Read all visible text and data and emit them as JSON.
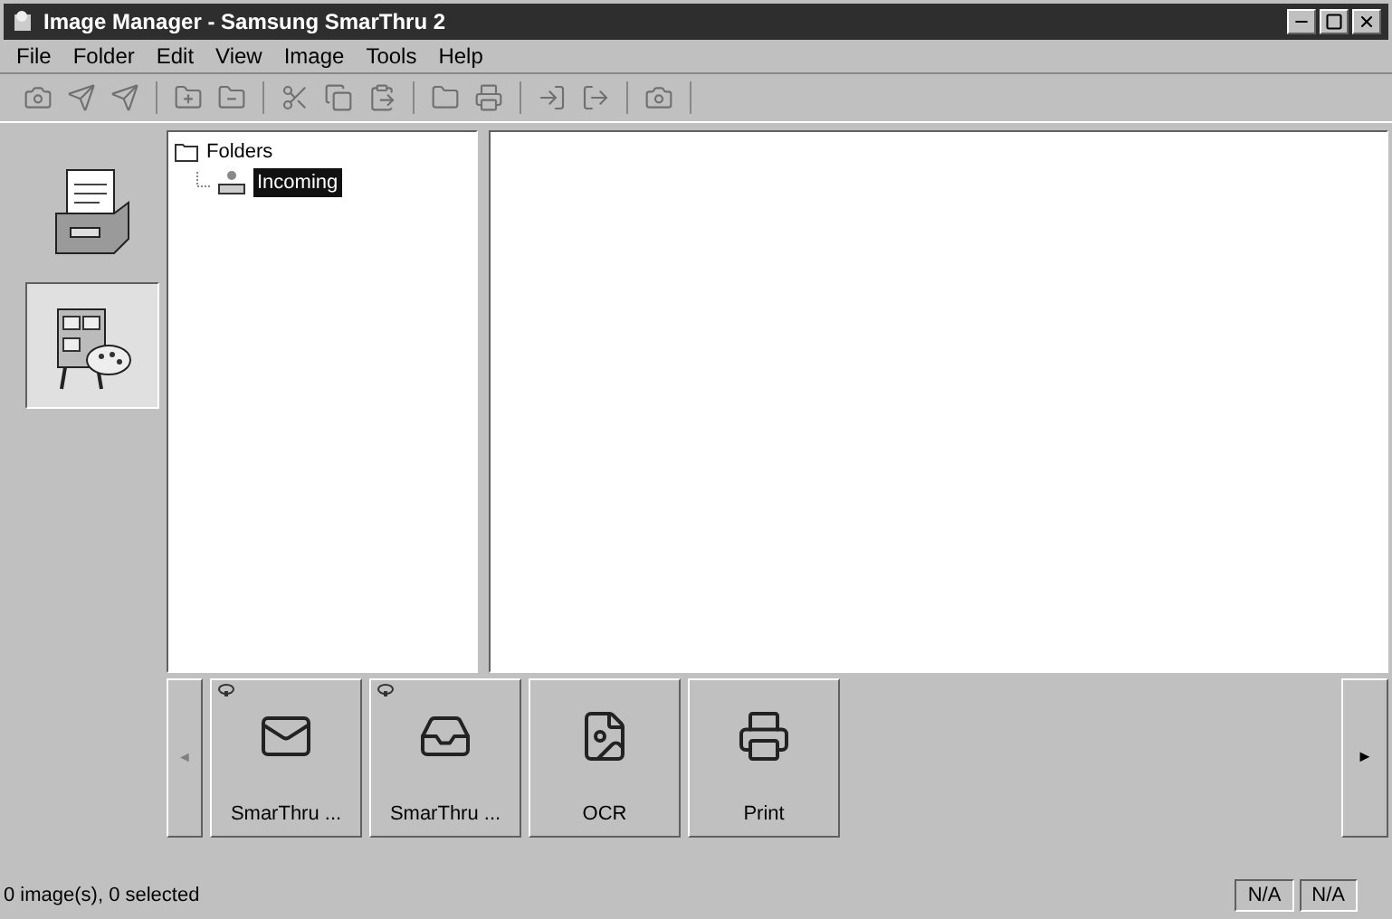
{
  "window": {
    "title": "Image Manager - Samsung SmarThru 2"
  },
  "menu": [
    "File",
    "Folder",
    "Edit",
    "View",
    "Image",
    "Tools",
    "Help"
  ],
  "sidebar": {
    "items": [
      {
        "kind": "cabinet",
        "selected": false
      },
      {
        "kind": "palette",
        "selected": true
      }
    ]
  },
  "tree": {
    "label": "Folders",
    "expanded": true,
    "children": [
      {
        "label": "Incoming",
        "selected": true
      }
    ]
  },
  "bottom_bar": {
    "left_arrow": "◄",
    "right_arrow": "►",
    "buttons": [
      {
        "kind": "scan",
        "label": "SmarThru ...",
        "pinned": true
      },
      {
        "kind": "fax",
        "label": "SmarThru ...",
        "pinned": true
      },
      {
        "kind": "ocr",
        "label": "OCR",
        "pinned": false
      },
      {
        "kind": "print",
        "label": "Print",
        "pinned": false
      }
    ]
  },
  "status_bar": {
    "text": "0 image(s), 0 selected",
    "panels": [
      "N/A",
      "N/A"
    ]
  }
}
